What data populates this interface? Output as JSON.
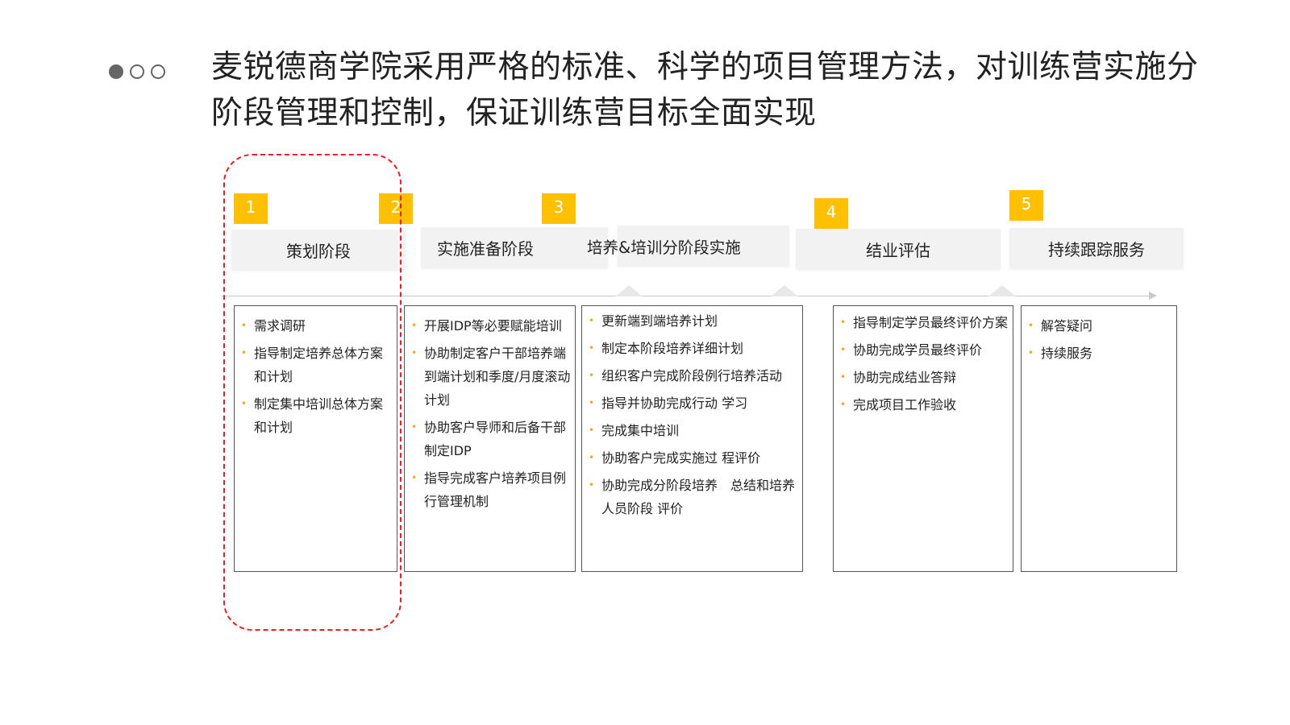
{
  "title": "麦锐德商学院采用严格的标准、科学的项目管理方法，对训练营实施分阶段管理和控制，保证训练营目标全面实现",
  "nav_dots": [
    "active",
    "inactive",
    "inactive"
  ],
  "colors": {
    "accent": "#ffc000",
    "highlight": "#ee1c25",
    "phase_bg": "#f2f2f2",
    "bullet": "#f5a623"
  },
  "stages": [
    {
      "number": "1",
      "label": "策划阶段",
      "items": [
        "需求调研",
        "指导制定培养总体方案和计划",
        "制定集中培训总体方案和计划"
      ]
    },
    {
      "number": "2",
      "label": "实施准备阶段",
      "items": [
        "开展IDP等必要赋能培训",
        "协助制定客户干部培养端到端计划和季度/月度滚动计划",
        "协助客户导师和后备干部制定IDP",
        "指导完成客户培养项目例行管理机制"
      ]
    },
    {
      "number": "3",
      "label": "培养&培训分阶段实施",
      "items": [
        "更新端到端培养计划",
        "制定本阶段培养详细计划",
        "组织客户完成阶段例行培养活动",
        "指导并协助完成行动 学习",
        "完成集中培训",
        "协助客户完成实施过 程评价",
        "协助完成分阶段培养　总结和培养人员阶段 评价"
      ]
    },
    {
      "number": "4",
      "label": "结业评估",
      "items": [
        "指导制定学员最终评价方案",
        "协助完成学员最终评价",
        "协助完成结业答辩",
        "完成项目工作验收"
      ]
    },
    {
      "number": "5",
      "label": "持续跟踪服务",
      "items": [
        "解答疑问",
        "持续服务"
      ]
    }
  ]
}
